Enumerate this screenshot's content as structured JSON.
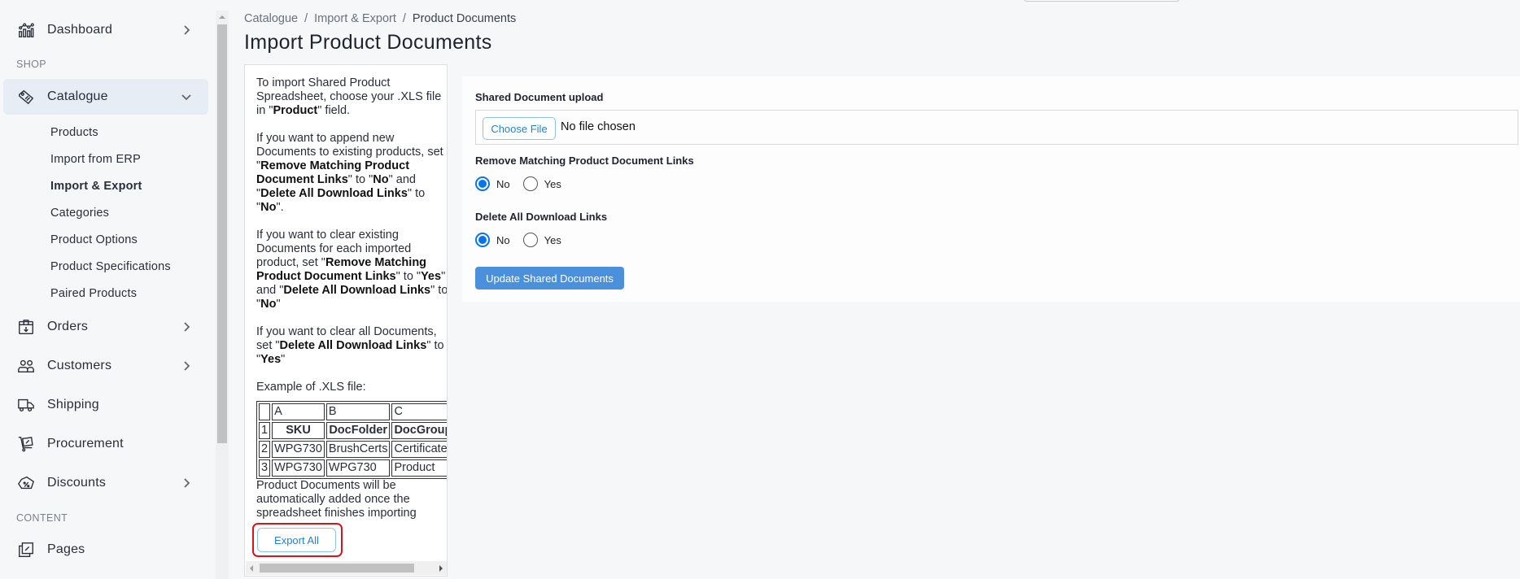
{
  "sidebar": {
    "items": [
      {
        "label": "Dashboard",
        "icon": "chart-icon",
        "has_chevron": true
      },
      {
        "label": "Catalogue",
        "icon": "tag-icon",
        "expanded": true
      },
      {
        "label": "Orders",
        "icon": "box-icon",
        "has_chevron": true
      },
      {
        "label": "Customers",
        "icon": "users-icon",
        "has_chevron": true
      },
      {
        "label": "Shipping",
        "icon": "truck-icon",
        "has_chevron": false
      },
      {
        "label": "Procurement",
        "icon": "cart-icon",
        "has_chevron": false
      },
      {
        "label": "Discounts",
        "icon": "discount-icon",
        "has_chevron": true
      },
      {
        "label": "Pages",
        "icon": "pages-icon",
        "has_chevron": false
      }
    ],
    "sections": {
      "shop": "SHOP",
      "content": "CONTENT"
    },
    "catalogue_sub": [
      "Products",
      "Import from ERP",
      "Import & Export",
      "Categories",
      "Product Options",
      "Product Specifications",
      "Paired Products"
    ],
    "current_sub": "Import & Export"
  },
  "breadcrumb": {
    "items": [
      "Catalogue",
      "Import & Export",
      "Product Documents"
    ],
    "separator": "/"
  },
  "page": {
    "title": "Import Product Documents"
  },
  "instructions": {
    "p1": {
      "a": "To import Shared Product Spreadsheet, choose your .XLS file in \"",
      "b": "Product",
      "c": "\" field."
    },
    "p2": {
      "a": "If you want to append new Documents to existing products, set \"",
      "b": "Remove Matching Product Document Links",
      "c": "\" to \"",
      "d": "No",
      "e": "\" and \"",
      "f": "Delete All Download Links",
      "g": "\" to \"",
      "h": "No",
      "i": "\"."
    },
    "p3": {
      "a": "If you want to clear existing Documents for each imported product, set \"",
      "b": "Remove Matching Product Document Links",
      "c": "\" to \"",
      "d": "Yes",
      "e": "\" and \"",
      "f": "Delete All Download Links",
      "g": "\" to \"",
      "h": "No",
      "i": "\""
    },
    "p4": {
      "a": "If you want to clear all Documents, set \"",
      "b": "Delete All Download Links",
      "c": "\" to \"",
      "d": "Yes",
      "e": "\""
    },
    "example_label": "Example of .XLS file:",
    "table": {
      "col_headers": [
        "",
        "A",
        "B",
        "C"
      ],
      "rows": [
        [
          "1",
          "SKU",
          "DocFolder",
          "DocGroupT"
        ],
        [
          "2",
          "WPG730",
          "BrushCerts",
          "Certificate"
        ],
        [
          "3",
          "WPG730",
          "WPG730",
          "Product"
        ]
      ]
    },
    "footer": "Product Documents will be automatically added once the spreadsheet finishes importing",
    "export_button": "Export All"
  },
  "form": {
    "upload_label": "Shared Document upload",
    "choose_file": "Choose File",
    "file_status": "No file chosen",
    "remove_links": {
      "label": "Remove Matching Product Document Links",
      "options": [
        "No",
        "Yes"
      ],
      "selected": "No"
    },
    "delete_links": {
      "label": "Delete All Download Links",
      "options": [
        "No",
        "Yes"
      ],
      "selected": "No"
    },
    "submit": "Update Shared Documents"
  },
  "colors": {
    "accent": "#4a90dc",
    "radio": "#0a74e6",
    "highlight": "#d8141b",
    "active_nav": "#e6edf5"
  }
}
